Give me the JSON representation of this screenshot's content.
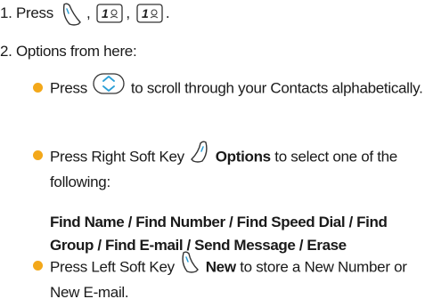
{
  "steps": {
    "step1_prefix": "1. Press",
    "step1_sep1": ",",
    "step1_sep2": ",",
    "step1_end": ".",
    "key_label": "1",
    "step2": "2. Options from here:"
  },
  "bullets": [
    {
      "pre": "Press",
      "post": "to scroll through your Contacts alphabetically."
    },
    {
      "pre": "Press Right Soft Key",
      "bold": "Options",
      "post": "to select one of the following:"
    },
    {
      "pre": "Press Left Soft Key",
      "bold": "New",
      "post": "to store a New Number or New E-mail."
    }
  ],
  "options_line": "Find Name / Find Number / Find Speed Dial / Find Group / Find E-mail / Send Message / Erase",
  "colors": {
    "bullet": "#f3a81a",
    "key_accent": "#2a9fd6"
  },
  "icons": [
    "left-soft-key-icon",
    "number-1-key-icon",
    "navigation-up-down-key-icon",
    "right-soft-key-icon"
  ]
}
